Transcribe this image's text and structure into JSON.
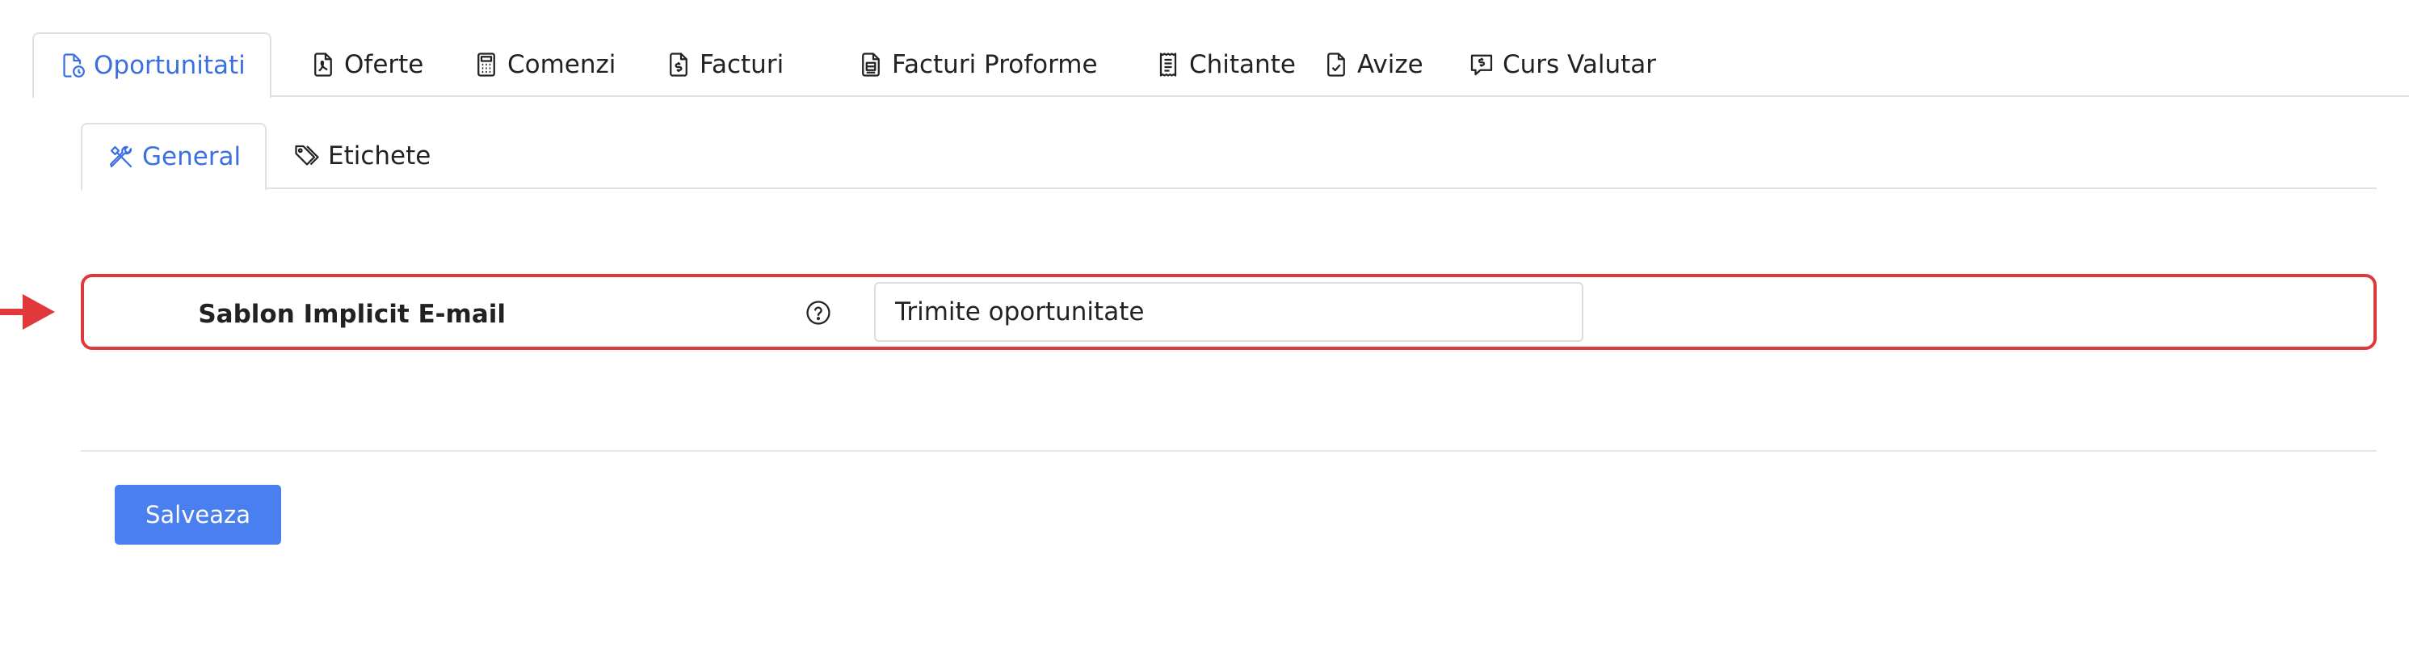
{
  "main_tabs": [
    {
      "label": "Oportunitati",
      "icon": "file-badge-icon",
      "active": true
    },
    {
      "label": "Oferte",
      "icon": "file-pdf-icon",
      "active": false
    },
    {
      "label": "Comenzi",
      "icon": "calculator-icon",
      "active": false
    },
    {
      "label": "Facturi",
      "icon": "file-dollar-icon",
      "active": false
    },
    {
      "label": "Facturi Proforme",
      "icon": "file-text-icon",
      "active": false
    },
    {
      "label": "Chitante",
      "icon": "receipt-icon",
      "active": false
    },
    {
      "label": "Avize",
      "icon": "file-check-icon",
      "active": false
    },
    {
      "label": "Curs Valutar",
      "icon": "chat-dollar-icon",
      "active": false
    }
  ],
  "sub_tabs": [
    {
      "label": "General",
      "icon": "tools-icon",
      "active": true
    },
    {
      "label": "Etichete",
      "icon": "tags-icon",
      "active": false
    }
  ],
  "form": {
    "field_label": "Sablon Implicit E-mail",
    "field_value": "Trimite oportunitate",
    "help_icon": "question-circle-icon"
  },
  "actions": {
    "save_label": "Salveaza"
  },
  "colors": {
    "accent": "#3b6fe0",
    "button": "#4a7ff0",
    "highlight": "#e0383b",
    "tab_border": "#dee2e6"
  }
}
